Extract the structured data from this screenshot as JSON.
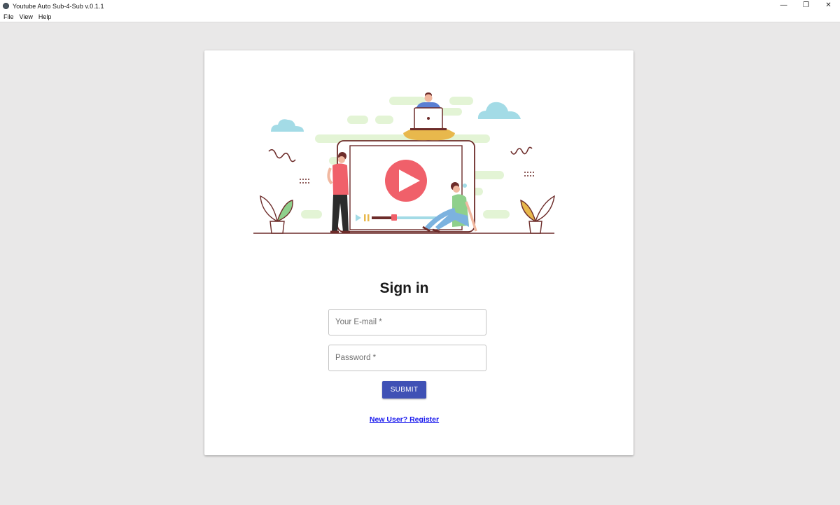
{
  "window": {
    "title": "Youtube Auto Sub-4-Sub v.0.1.1",
    "controls": {
      "minimize": "—",
      "restore": "❐",
      "close": "✕"
    }
  },
  "menu": {
    "items": [
      {
        "label": "File"
      },
      {
        "label": "View"
      },
      {
        "label": "Help"
      }
    ]
  },
  "signin": {
    "title": "Sign in",
    "email_placeholder": "Your E-mail *",
    "password_placeholder": "Password *",
    "submit_label": "SUBMIT",
    "register_link": "New User? Register"
  },
  "colors": {
    "accent": "#3f51b5",
    "link": "#1a1aee",
    "background": "#e9e8e8",
    "play_button": "#f0606a"
  }
}
